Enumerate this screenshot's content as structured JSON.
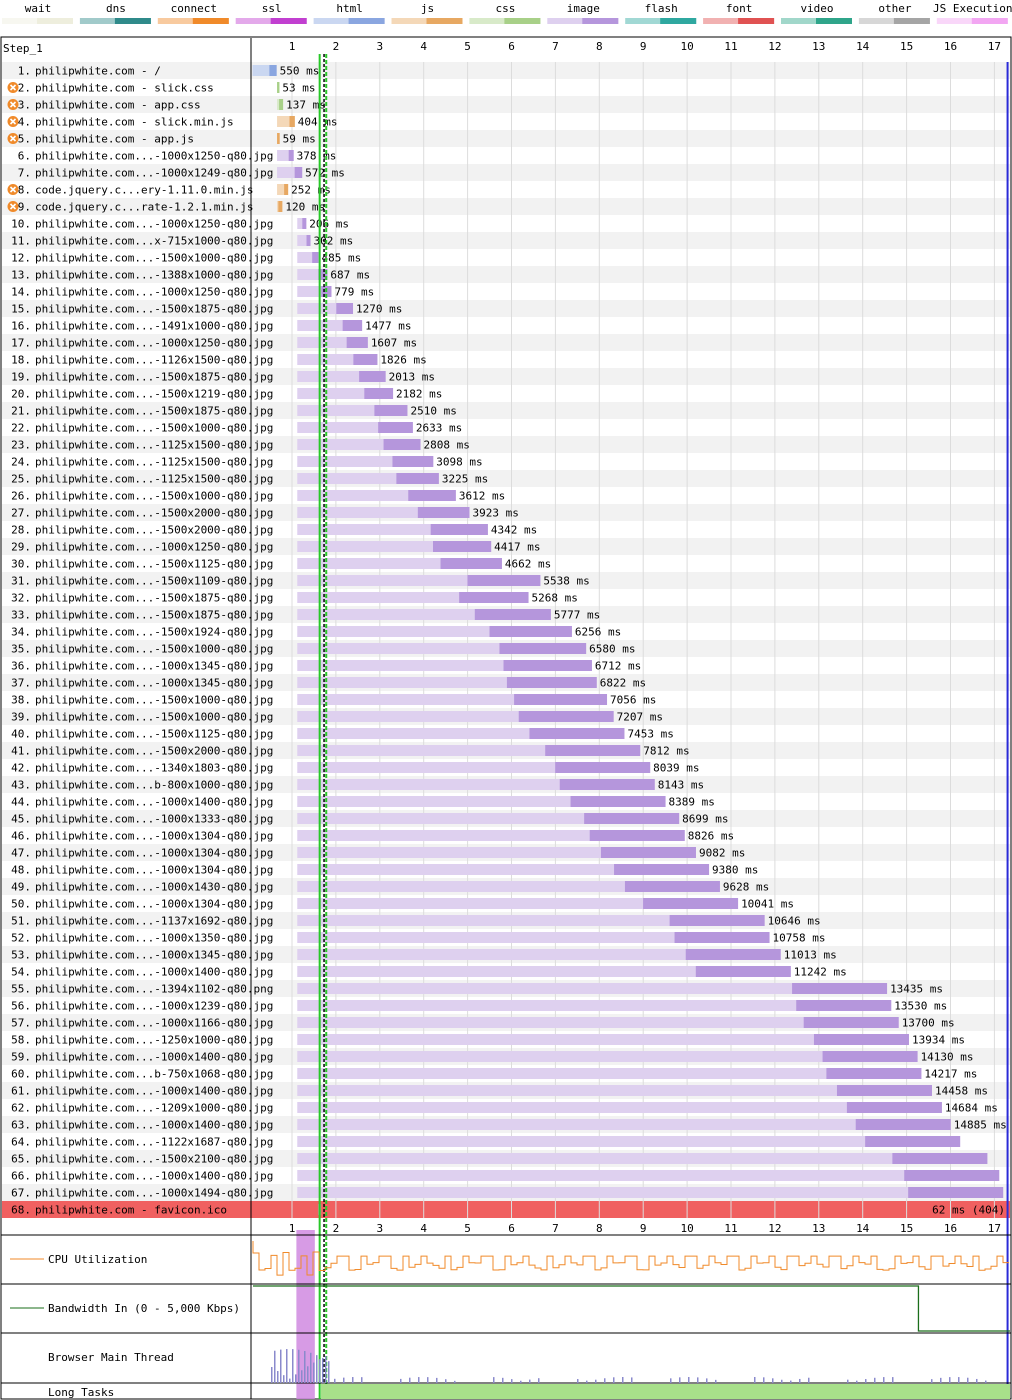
{
  "legend": [
    {
      "label": "wait",
      "color": "#eeeedd"
    },
    {
      "label": "dns",
      "color": "#2f8a8a"
    },
    {
      "label": "connect",
      "color": "#f08a2a"
    },
    {
      "label": "ssl",
      "color": "#c13fd0"
    },
    {
      "label": "html",
      "color": "#8aa6e0"
    },
    {
      "label": "js",
      "color": "#e7a862"
    },
    {
      "label": "css",
      "color": "#a8d088"
    },
    {
      "label": "image",
      "color": "#b596dc"
    },
    {
      "label": "flash",
      "color": "#2fa8a0"
    },
    {
      "label": "font",
      "color": "#e05252"
    },
    {
      "label": "video",
      "color": "#2fa58a"
    },
    {
      "label": "other",
      "color": "#a5a5a5"
    },
    {
      "label": "JS Execution",
      "color": "#f2a6f2"
    }
  ],
  "step_label": "Step_1",
  "panels": {
    "cpu": "CPU Utilization",
    "bandwidth": "Bandwidth In (0 - 5,000 Kbps)",
    "main_thread": "Browser Main Thread",
    "long_tasks": "Long Tasks"
  },
  "chart_data": {
    "type": "waterfall",
    "x_unit": "seconds",
    "xlim": [
      0.1,
      17.3
    ],
    "x_ticks": [
      1,
      2,
      3,
      4,
      5,
      6,
      7,
      8,
      9,
      10,
      11,
      12,
      13,
      14,
      15,
      16,
      17
    ],
    "markers": {
      "start_render": 1.63,
      "dom_content_loaded": 1.78,
      "on_load": 1.73,
      "document_complete": 17.3
    },
    "requests": [
      {
        "n": 1,
        "label": "philipwhite.com - /",
        "type": "html",
        "warn": false,
        "start": 0.1,
        "dur_ms": 550,
        "time_label": "550 ms",
        "status": ""
      },
      {
        "n": 2,
        "label": "philipwhite.com - slick.css",
        "type": "css",
        "warn": true,
        "start": 0.66,
        "dur_ms": 53,
        "time_label": "53 ms",
        "status": ""
      },
      {
        "n": 3,
        "label": "philipwhite.com - app.css",
        "type": "css",
        "warn": true,
        "start": 0.66,
        "dur_ms": 137,
        "time_label": "137 ms",
        "status": ""
      },
      {
        "n": 4,
        "label": "philipwhite.com - slick.min.js",
        "type": "js",
        "warn": true,
        "start": 0.66,
        "dur_ms": 404,
        "time_label": "404 ms",
        "status": ""
      },
      {
        "n": 5,
        "label": "philipwhite.com - app.js",
        "type": "js",
        "warn": true,
        "start": 0.66,
        "dur_ms": 59,
        "time_label": "59 ms",
        "status": ""
      },
      {
        "n": 6,
        "label": "philipwhite.com...-1000x1250-q80.jpg",
        "type": "image",
        "warn": false,
        "start": 0.66,
        "dur_ms": 378,
        "time_label": "378 ms",
        "status": ""
      },
      {
        "n": 7,
        "label": "philipwhite.com...-1000x1249-q80.jpg",
        "type": "image",
        "warn": false,
        "start": 0.66,
        "dur_ms": 572,
        "time_label": "572 ms",
        "status": ""
      },
      {
        "n": 8,
        "label": "code.jquery.c...ery-1.11.0.min.js",
        "type": "js",
        "warn": true,
        "start": 0.66,
        "dur_ms": 252,
        "time_label": "252 ms",
        "status": ""
      },
      {
        "n": 9,
        "label": "code.jquery.c...rate-1.2.1.min.js",
        "type": "js",
        "warn": true,
        "start": 0.66,
        "dur_ms": 120,
        "time_label": "120 ms",
        "status": ""
      },
      {
        "n": 10,
        "label": "philipwhite.com...-1000x1250-q80.jpg",
        "type": "image",
        "warn": false,
        "start": 1.12,
        "dur_ms": 206,
        "time_label": "206 ms",
        "status": ""
      },
      {
        "n": 11,
        "label": "philipwhite.com...x-715x1000-q80.jpg",
        "type": "image",
        "warn": false,
        "start": 1.12,
        "dur_ms": 302,
        "time_label": "302 ms",
        "status": ""
      },
      {
        "n": 12,
        "label": "philipwhite.com...-1500x1000-q80.jpg",
        "type": "image",
        "warn": false,
        "start": 1.12,
        "dur_ms": 485,
        "time_label": "485 ms",
        "status": ""
      },
      {
        "n": 13,
        "label": "philipwhite.com...-1388x1000-q80.jpg",
        "type": "image",
        "warn": false,
        "start": 1.12,
        "dur_ms": 687,
        "time_label": "687 ms",
        "status": ""
      },
      {
        "n": 14,
        "label": "philipwhite.com...-1000x1250-q80.jpg",
        "type": "image",
        "warn": false,
        "start": 1.12,
        "dur_ms": 779,
        "time_label": "779 ms",
        "status": ""
      },
      {
        "n": 15,
        "label": "philipwhite.com...-1500x1875-q80.jpg",
        "type": "image",
        "warn": false,
        "start": 1.12,
        "dur_ms": 1270,
        "time_label": "1270 ms",
        "status": ""
      },
      {
        "n": 16,
        "label": "philipwhite.com...-1491x1000-q80.jpg",
        "type": "image",
        "warn": false,
        "start": 1.12,
        "dur_ms": 1477,
        "time_label": "1477 ms",
        "status": ""
      },
      {
        "n": 17,
        "label": "philipwhite.com...-1000x1250-q80.jpg",
        "type": "image",
        "warn": false,
        "start": 1.12,
        "dur_ms": 1607,
        "time_label": "1607 ms",
        "status": ""
      },
      {
        "n": 18,
        "label": "philipwhite.com...-1126x1500-q80.jpg",
        "type": "image",
        "warn": false,
        "start": 1.12,
        "dur_ms": 1826,
        "time_label": "1826 ms",
        "status": ""
      },
      {
        "n": 19,
        "label": "philipwhite.com...-1500x1875-q80.jpg",
        "type": "image",
        "warn": false,
        "start": 1.12,
        "dur_ms": 2013,
        "time_label": "2013 ms",
        "status": ""
      },
      {
        "n": 20,
        "label": "philipwhite.com...-1500x1219-q80.jpg",
        "type": "image",
        "warn": false,
        "start": 1.12,
        "dur_ms": 2182,
        "time_label": "2182 ms",
        "status": ""
      },
      {
        "n": 21,
        "label": "philipwhite.com...-1500x1875-q80.jpg",
        "type": "image",
        "warn": false,
        "start": 1.12,
        "dur_ms": 2510,
        "time_label": "2510 ms",
        "status": ""
      },
      {
        "n": 22,
        "label": "philipwhite.com...-1500x1000-q80.jpg",
        "type": "image",
        "warn": false,
        "start": 1.12,
        "dur_ms": 2633,
        "time_label": "2633 ms",
        "status": ""
      },
      {
        "n": 23,
        "label": "philipwhite.com...-1125x1500-q80.jpg",
        "type": "image",
        "warn": false,
        "start": 1.12,
        "dur_ms": 2808,
        "time_label": "2808 ms",
        "status": ""
      },
      {
        "n": 24,
        "label": "philipwhite.com...-1125x1500-q80.jpg",
        "type": "image",
        "warn": false,
        "start": 1.12,
        "dur_ms": 3098,
        "time_label": "3098 ms",
        "status": ""
      },
      {
        "n": 25,
        "label": "philipwhite.com...-1125x1500-q80.jpg",
        "type": "image",
        "warn": false,
        "start": 1.12,
        "dur_ms": 3225,
        "time_label": "3225 ms",
        "status": ""
      },
      {
        "n": 26,
        "label": "philipwhite.com...-1500x1000-q80.jpg",
        "type": "image",
        "warn": false,
        "start": 1.12,
        "dur_ms": 3612,
        "time_label": "3612 ms",
        "status": ""
      },
      {
        "n": 27,
        "label": "philipwhite.com...-1500x2000-q80.jpg",
        "type": "image",
        "warn": false,
        "start": 1.12,
        "dur_ms": 3923,
        "time_label": "3923 ms",
        "status": ""
      },
      {
        "n": 28,
        "label": "philipwhite.com...-1500x2000-q80.jpg",
        "type": "image",
        "warn": false,
        "start": 1.12,
        "dur_ms": 4342,
        "time_label": "4342 ms",
        "status": ""
      },
      {
        "n": 29,
        "label": "philipwhite.com...-1000x1250-q80.jpg",
        "type": "image",
        "warn": false,
        "start": 1.12,
        "dur_ms": 4417,
        "time_label": "4417 ms",
        "status": ""
      },
      {
        "n": 30,
        "label": "philipwhite.com...-1500x1125-q80.jpg",
        "type": "image",
        "warn": false,
        "start": 1.12,
        "dur_ms": 4662,
        "time_label": "4662 ms",
        "status": ""
      },
      {
        "n": 31,
        "label": "philipwhite.com...-1500x1109-q80.jpg",
        "type": "image",
        "warn": false,
        "start": 1.12,
        "dur_ms": 5538,
        "time_label": "5538 ms",
        "status": ""
      },
      {
        "n": 32,
        "label": "philipwhite.com...-1500x1875-q80.jpg",
        "type": "image",
        "warn": false,
        "start": 1.12,
        "dur_ms": 5268,
        "time_label": "5268 ms",
        "status": ""
      },
      {
        "n": 33,
        "label": "philipwhite.com...-1500x1875-q80.jpg",
        "type": "image",
        "warn": false,
        "start": 1.12,
        "dur_ms": 5777,
        "time_label": "5777 ms",
        "status": ""
      },
      {
        "n": 34,
        "label": "philipwhite.com...-1500x1924-q80.jpg",
        "type": "image",
        "warn": false,
        "start": 1.12,
        "dur_ms": 6256,
        "time_label": "6256 ms",
        "status": ""
      },
      {
        "n": 35,
        "label": "philipwhite.com...-1500x1000-q80.jpg",
        "type": "image",
        "warn": false,
        "start": 1.12,
        "dur_ms": 6580,
        "time_label": "6580 ms",
        "status": ""
      },
      {
        "n": 36,
        "label": "philipwhite.com...-1000x1345-q80.jpg",
        "type": "image",
        "warn": false,
        "start": 1.12,
        "dur_ms": 6712,
        "time_label": "6712 ms",
        "status": ""
      },
      {
        "n": 37,
        "label": "philipwhite.com...-1000x1345-q80.jpg",
        "type": "image",
        "warn": false,
        "start": 1.12,
        "dur_ms": 6822,
        "time_label": "6822 ms",
        "status": ""
      },
      {
        "n": 38,
        "label": "philipwhite.com...-1500x1000-q80.jpg",
        "type": "image",
        "warn": false,
        "start": 1.12,
        "dur_ms": 7056,
        "time_label": "7056 ms",
        "status": ""
      },
      {
        "n": 39,
        "label": "philipwhite.com...-1500x1000-q80.jpg",
        "type": "image",
        "warn": false,
        "start": 1.12,
        "dur_ms": 7207,
        "time_label": "7207 ms",
        "status": ""
      },
      {
        "n": 40,
        "label": "philipwhite.com...-1500x1125-q80.jpg",
        "type": "image",
        "warn": false,
        "start": 1.12,
        "dur_ms": 7453,
        "time_label": "7453 ms",
        "status": ""
      },
      {
        "n": 41,
        "label": "philipwhite.com...-1500x2000-q80.jpg",
        "type": "image",
        "warn": false,
        "start": 1.12,
        "dur_ms": 7812,
        "time_label": "7812 ms",
        "status": ""
      },
      {
        "n": 42,
        "label": "philipwhite.com...-1340x1803-q80.jpg",
        "type": "image",
        "warn": false,
        "start": 1.12,
        "dur_ms": 8039,
        "time_label": "8039 ms",
        "status": ""
      },
      {
        "n": 43,
        "label": "philipwhite.com...b-800x1000-q80.jpg",
        "type": "image",
        "warn": false,
        "start": 1.12,
        "dur_ms": 8143,
        "time_label": "8143 ms",
        "status": ""
      },
      {
        "n": 44,
        "label": "philipwhite.com...-1000x1400-q80.jpg",
        "type": "image",
        "warn": false,
        "start": 1.12,
        "dur_ms": 8389,
        "time_label": "8389 ms",
        "status": ""
      },
      {
        "n": 45,
        "label": "philipwhite.com...-1000x1333-q80.jpg",
        "type": "image",
        "warn": false,
        "start": 1.12,
        "dur_ms": 8699,
        "time_label": "8699 ms",
        "status": ""
      },
      {
        "n": 46,
        "label": "philipwhite.com...-1000x1304-q80.jpg",
        "type": "image",
        "warn": false,
        "start": 1.12,
        "dur_ms": 8826,
        "time_label": "8826 ms",
        "status": ""
      },
      {
        "n": 47,
        "label": "philipwhite.com...-1000x1304-q80.jpg",
        "type": "image",
        "warn": false,
        "start": 1.12,
        "dur_ms": 9082,
        "time_label": "9082 ms",
        "status": ""
      },
      {
        "n": 48,
        "label": "philipwhite.com...-1000x1304-q80.jpg",
        "type": "image",
        "warn": false,
        "start": 1.12,
        "dur_ms": 9380,
        "time_label": "9380 ms",
        "status": ""
      },
      {
        "n": 49,
        "label": "philipwhite.com...-1000x1430-q80.jpg",
        "type": "image",
        "warn": false,
        "start": 1.12,
        "dur_ms": 9628,
        "time_label": "9628 ms",
        "status": ""
      },
      {
        "n": 50,
        "label": "philipwhite.com...-1000x1304-q80.jpg",
        "type": "image",
        "warn": false,
        "start": 1.12,
        "dur_ms": 10041,
        "time_label": "10041 ms",
        "status": ""
      },
      {
        "n": 51,
        "label": "philipwhite.com...-1137x1692-q80.jpg",
        "type": "image",
        "warn": false,
        "start": 1.12,
        "dur_ms": 10646,
        "time_label": "10646 ms",
        "status": ""
      },
      {
        "n": 52,
        "label": "philipwhite.com...-1000x1350-q80.jpg",
        "type": "image",
        "warn": false,
        "start": 1.12,
        "dur_ms": 10758,
        "time_label": "10758 ms",
        "status": ""
      },
      {
        "n": 53,
        "label": "philipwhite.com...-1000x1345-q80.jpg",
        "type": "image",
        "warn": false,
        "start": 1.12,
        "dur_ms": 11013,
        "time_label": "11013 ms",
        "status": ""
      },
      {
        "n": 54,
        "label": "philipwhite.com...-1000x1400-q80.jpg",
        "type": "image",
        "warn": false,
        "start": 1.12,
        "dur_ms": 11242,
        "time_label": "11242 ms",
        "status": ""
      },
      {
        "n": 55,
        "label": "philipwhite.com...-1394x1102-q80.png",
        "type": "image",
        "warn": false,
        "start": 1.12,
        "dur_ms": 13435,
        "time_label": "13435 ms",
        "status": ""
      },
      {
        "n": 56,
        "label": "philipwhite.com...-1000x1239-q80.jpg",
        "type": "image",
        "warn": false,
        "start": 1.12,
        "dur_ms": 13530,
        "time_label": "13530 ms",
        "status": ""
      },
      {
        "n": 57,
        "label": "philipwhite.com...-1000x1166-q80.jpg",
        "type": "image",
        "warn": false,
        "start": 1.12,
        "dur_ms": 13700,
        "time_label": "13700 ms",
        "status": ""
      },
      {
        "n": 58,
        "label": "philipwhite.com...-1250x1000-q80.jpg",
        "type": "image",
        "warn": false,
        "start": 1.12,
        "dur_ms": 13934,
        "time_label": "13934 ms",
        "status": ""
      },
      {
        "n": 59,
        "label": "philipwhite.com...-1000x1400-q80.jpg",
        "type": "image",
        "warn": false,
        "start": 1.12,
        "dur_ms": 14130,
        "time_label": "14130 ms",
        "status": ""
      },
      {
        "n": 60,
        "label": "philipwhite.com...b-750x1068-q80.jpg",
        "type": "image",
        "warn": false,
        "start": 1.12,
        "dur_ms": 14217,
        "time_label": "14217 ms",
        "status": ""
      },
      {
        "n": 61,
        "label": "philipwhite.com...-1000x1400-q80.jpg",
        "type": "image",
        "warn": false,
        "start": 1.12,
        "dur_ms": 14458,
        "time_label": "14458 ms",
        "status": ""
      },
      {
        "n": 62,
        "label": "philipwhite.com...-1209x1000-q80.jpg",
        "type": "image",
        "warn": false,
        "start": 1.12,
        "dur_ms": 14684,
        "time_label": "14684 ms",
        "status": ""
      },
      {
        "n": 63,
        "label": "philipwhite.com...-1000x1400-q80.jpg",
        "type": "image",
        "warn": false,
        "start": 1.12,
        "dur_ms": 14885,
        "time_label": "14885 ms",
        "status": ""
      },
      {
        "n": 64,
        "label": "philipwhite.com...-1122x1687-q80.jpg",
        "type": "image",
        "warn": false,
        "start": 1.12,
        "dur_ms": 15100,
        "time_label": "",
        "status": ""
      },
      {
        "n": 65,
        "label": "philipwhite.com...-1500x2100-q80.jpg",
        "type": "image",
        "warn": false,
        "start": 1.12,
        "dur_ms": 15720,
        "time_label": "",
        "status": ""
      },
      {
        "n": 66,
        "label": "philipwhite.com...-1000x1400-q80.jpg",
        "type": "image",
        "warn": false,
        "start": 1.12,
        "dur_ms": 15990,
        "time_label": "",
        "status": ""
      },
      {
        "n": 67,
        "label": "philipwhite.com...-1000x1494-q80.jpg",
        "type": "image",
        "warn": false,
        "start": 1.12,
        "dur_ms": 16080,
        "time_label": "",
        "status": ""
      },
      {
        "n": 68,
        "label": "philipwhite.com - favicon.ico",
        "type": "other",
        "warn": false,
        "start": 1.6,
        "dur_ms": 62,
        "time_label": "62 ms (404)",
        "status": "404"
      }
    ]
  }
}
